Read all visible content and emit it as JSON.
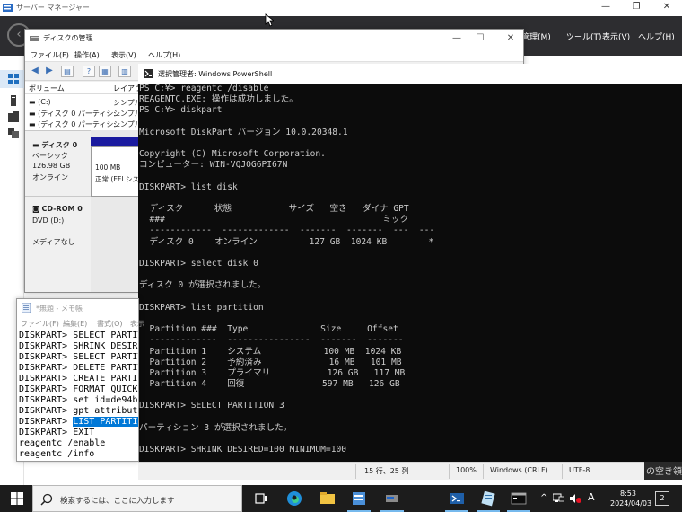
{
  "server_manager": {
    "title": "サーバー マネージャー",
    "menus": [
      "管理(M)",
      "ツール(T)",
      "表示(V)",
      "ヘルプ(H)"
    ],
    "right_edge_text": "の空き領"
  },
  "disk_management": {
    "title": "ディスクの管理",
    "menus": [
      "ファイル(F)",
      "操作(A)",
      "表示(V)",
      "ヘルプ(H)"
    ],
    "columns": [
      "ボリューム",
      "レイアウ"
    ],
    "volumes": [
      {
        "name": "(C:)",
        "layout": "シンプル"
      },
      {
        "name": "(ディスク 0 パーティシ...",
        "layout": "シンプル"
      },
      {
        "name": "(ディスク 0 パーティシ...",
        "layout": "シンプル"
      }
    ],
    "disk0": {
      "name": "ディスク 0",
      "type": "ベーシック",
      "size": "126.98 GB",
      "status": "オンライン"
    },
    "partition": {
      "size": "100 MB",
      "status": "正常 (EFI シス"
    },
    "cdrom": {
      "name": "CD-ROM 0",
      "drive": "DVD (D:)",
      "media": "メディアなし"
    }
  },
  "powershell": {
    "title": "選択管理者: Windows PowerShell",
    "lines": [
      "PS C:¥> reagentc /disable",
      "REAGENTC.EXE: 操作は成功しました。",
      "PS C:¥> diskpart",
      "",
      "Microsoft DiskPart バージョン 10.0.20348.1",
      "",
      "Copyright (C) Microsoft Corporation.",
      "コンピューター: WIN-VQJOG6PI67N",
      "",
      "DISKPART> list disk",
      "",
      "  ディスク      状態           サイズ   空き   ダイナ GPT",
      "  ###                                          ミック",
      "  ------------  -------------  -------  -------  ---  ---",
      "  ディスク 0    オンライン          127 GB  1024 KB        *",
      "",
      "DISKPART> select disk 0",
      "",
      "ディスク 0 が選択されました。",
      "",
      "DISKPART> list partition",
      "",
      "  Partition ###  Type              Size     Offset",
      "  -------------  ----------------  -------  -------",
      "  Partition 1    システム            100 MB  1024 KB",
      "  Partition 2    予約済み             16 MB   101 MB",
      "  Partition 3    プライマリ           126 GB   117 MB",
      "  Partition 4    回復               597 MB   126 GB",
      "",
      "DISKPART> SELECT PARTITION 3",
      "",
      "パーティション 3 が選択されました。",
      "",
      "DISKPART> SHRINK DESIRED=100 MINIMUM=100"
    ]
  },
  "notepad": {
    "title": "*無題 - メモ帳",
    "menus": [
      "ファイル(F)",
      "編集(E)",
      "書式(O)",
      "表示"
    ],
    "lines": [
      "DISKPART> SELECT PARTITI",
      "DISKPART> SHRINK DESIRE",
      "DISKPART> SELECT PARTIT",
      "DISKPART> DELETE PARTIT",
      "DISKPART> CREATE PARTIT",
      "DISKPART> FORMAT QUICK",
      "DISKPART> set id=de94bb",
      "DISKPART> gpt attribute",
      "DISKPART> LIST PARTITIO",
      "DISKPART> EXIT",
      "reagentc /enable",
      "reagentc /info"
    ],
    "selected_line_prefix": "DISKPART> ",
    "selected_text": "LIST PARTITIO",
    "selected_index": 8,
    "status": {
      "position": "15 行、25 列",
      "zoom": "100%",
      "line_ending": "Windows (CRLF)",
      "encoding": "UTF-8"
    }
  },
  "taskbar": {
    "search_placeholder": "検索するには、ここに入力します",
    "ime": "A",
    "time": "8:53",
    "date": "2024/04/03",
    "notification_count": "2"
  }
}
